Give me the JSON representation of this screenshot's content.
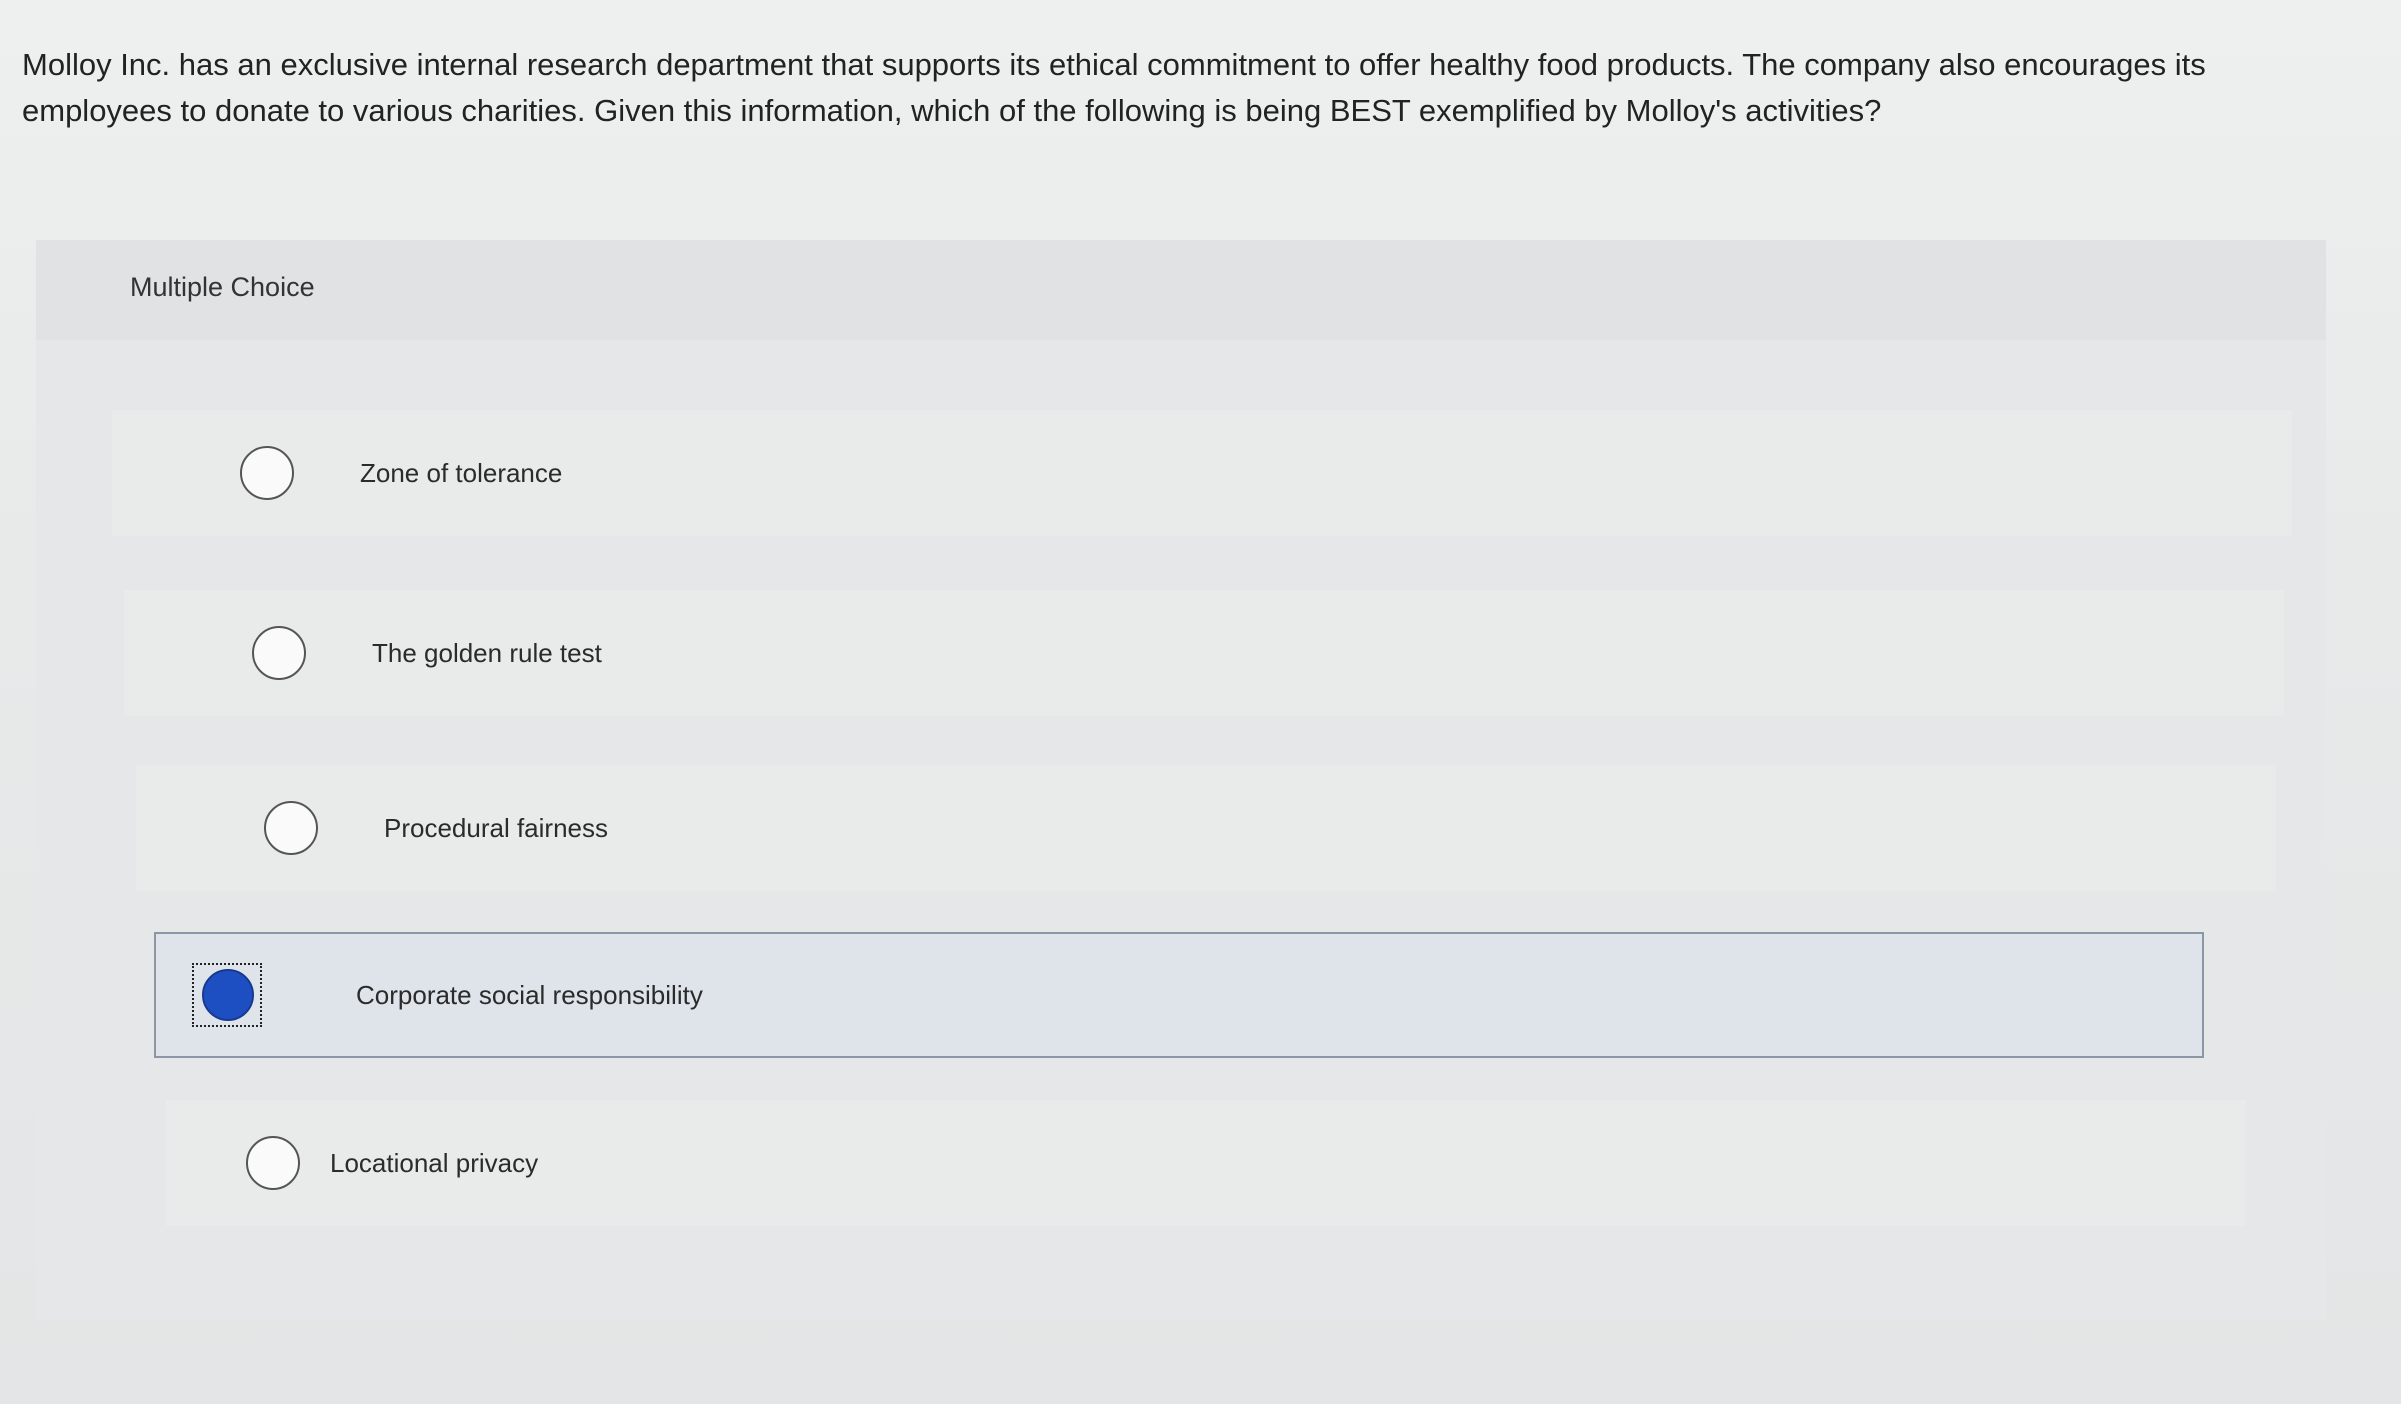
{
  "question": {
    "text": "Molloy Inc. has an exclusive internal research department that supports its ethical commitment to offer healthy food products. The company also encourages its employees to donate to various charities. Given this information, which of the following is being BEST exemplified by Molloy's activities?"
  },
  "panel": {
    "title": "Multiple Choice"
  },
  "options": [
    {
      "label": "Zone of tolerance",
      "selected": false
    },
    {
      "label": "The golden rule test",
      "selected": false
    },
    {
      "label": "Procedural fairness",
      "selected": false
    },
    {
      "label": "Corporate social responsibility",
      "selected": true
    },
    {
      "label": "Locational privacy",
      "selected": false
    }
  ],
  "colors": {
    "selected_radio": "#1e4fc2",
    "selected_border": "#8c97a5"
  }
}
